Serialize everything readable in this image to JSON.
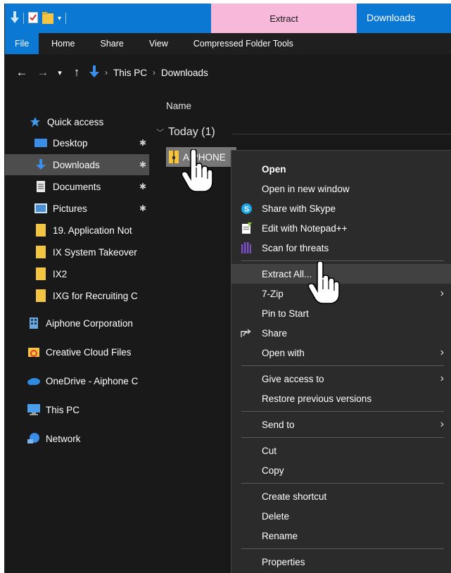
{
  "ribbon_context": {
    "extract_tab": "Extract",
    "window_title": "Downloads"
  },
  "ribbon": {
    "tabs": [
      "File",
      "Home",
      "Share",
      "View",
      "Compressed Folder Tools"
    ]
  },
  "address": {
    "crumbs": [
      "This PC",
      "Downloads"
    ]
  },
  "navpane": {
    "items": [
      {
        "label": "Quick access",
        "icon": "star-icon"
      },
      {
        "label": "Desktop",
        "icon": "desktop-folder-icon",
        "pinned": true
      },
      {
        "label": "Downloads",
        "icon": "download-arrow-icon",
        "pinned": true,
        "selected": true
      },
      {
        "label": "Documents",
        "icon": "documents-icon",
        "pinned": true
      },
      {
        "label": "Pictures",
        "icon": "pictures-icon",
        "pinned": true
      },
      {
        "label": "19. Application Not",
        "icon": "folder-icon"
      },
      {
        "label": "IX System Takeover",
        "icon": "folder-icon"
      },
      {
        "label": "IX2",
        "icon": "folder-icon"
      },
      {
        "label": "IXG for Recruiting C",
        "icon": "folder-icon"
      },
      {
        "label": "Aiphone Corporation",
        "icon": "building-icon"
      },
      {
        "label": "Creative Cloud Files",
        "icon": "creative-cloud-icon"
      },
      {
        "label": "OneDrive - Aiphone C",
        "icon": "onedrive-cloud-icon"
      },
      {
        "label": "This PC",
        "icon": "computer-icon"
      },
      {
        "label": "Network",
        "icon": "network-icon"
      }
    ],
    "pin_glyph": "📌"
  },
  "content": {
    "column_header": "Name",
    "group_header": "Today (1)",
    "file_name": "AIPHONE"
  },
  "context_menu": {
    "items": [
      {
        "label": "Open",
        "bold": true
      },
      {
        "label": "Open in new window"
      },
      {
        "label": "Share with Skype",
        "icon": "skype-icon"
      },
      {
        "label": "Edit with Notepad++",
        "icon": "notepad-plus-plus-icon"
      },
      {
        "label": "Scan for threats",
        "icon": "scan-threats-icon"
      },
      {
        "label": "Extract All...",
        "hover": true
      },
      {
        "label": "7-Zip",
        "submenu": true
      },
      {
        "label": "Pin to Start"
      },
      {
        "label": "Share",
        "icon": "share-icon"
      },
      {
        "label": "Open with",
        "submenu": true
      },
      {
        "label": "Give access to",
        "submenu": true
      },
      {
        "label": "Restore previous versions"
      },
      {
        "label": "Send to",
        "submenu": true
      },
      {
        "label": "Cut"
      },
      {
        "label": "Copy"
      },
      {
        "label": "Create shortcut"
      },
      {
        "label": "Delete"
      },
      {
        "label": "Rename"
      },
      {
        "label": "Properties"
      }
    ]
  },
  "colors": {
    "title_blue": "#0b78d4",
    "extract_pink": "#f7b8d9",
    "window_bg": "#191919",
    "menu_bg": "#2b2b2b",
    "selected_bg": "#4d4d4d"
  }
}
